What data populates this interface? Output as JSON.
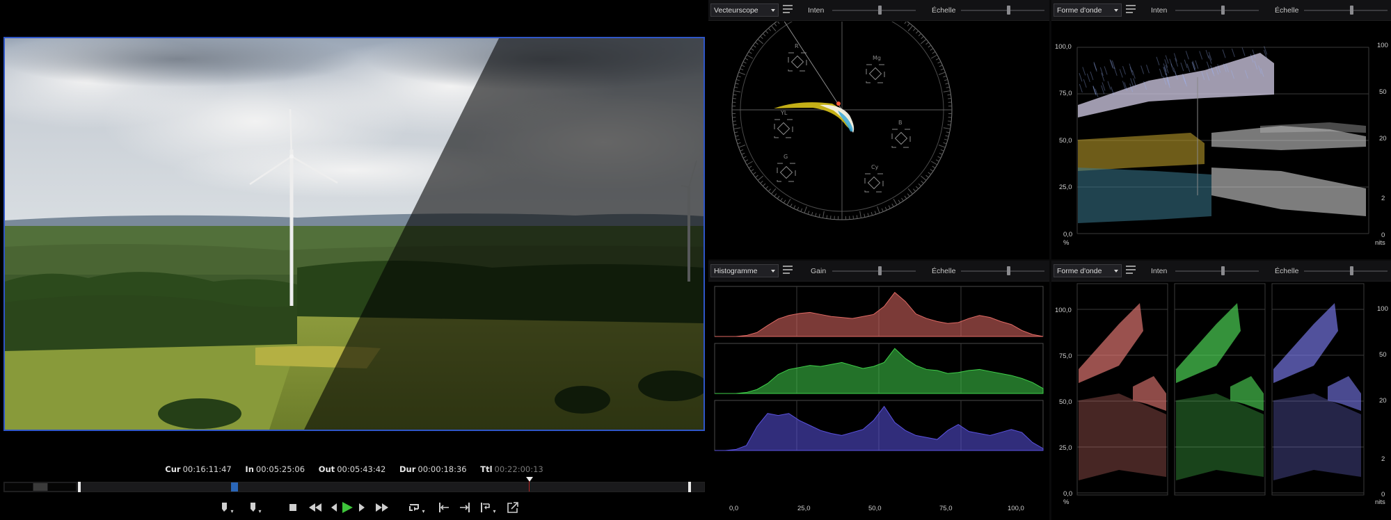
{
  "player": {
    "timecodes": [
      {
        "label": "Cur",
        "value": "00:16:11:47"
      },
      {
        "label": "In",
        "value": "00:05:25:06"
      },
      {
        "label": "Out",
        "value": "00:05:43:42"
      },
      {
        "label": "Dur",
        "value": "00:00:18:36"
      },
      {
        "label": "Ttl",
        "value": "00:22:00:13"
      }
    ],
    "playhead_fraction": 0.325
  },
  "scopes": {
    "vectorscope": {
      "mode": "Vecteurscope",
      "slider1_label": "Inten",
      "slider2_label": "Échelle",
      "targets": [
        "R",
        "Mg",
        "B",
        "Cy",
        "G",
        "YL"
      ]
    },
    "waveform_top": {
      "mode": "Forme d'onde",
      "slider1_label": "Inten",
      "slider2_label": "Échelle",
      "left_ticks": [
        "100,0",
        "75,0",
        "50,0",
        "25,0",
        "0,0"
      ],
      "right_ticks": [
        "100",
        "50",
        "20",
        "2",
        "0"
      ],
      "left_unit": "%",
      "right_unit": "nits"
    },
    "histogram": {
      "mode": "Histogramme",
      "slider1_label": "Gain",
      "slider2_label": "Échelle",
      "x_ticks": [
        "0,0",
        "25,0",
        "50,0",
        "75,0",
        "100,0"
      ],
      "channel_colors": [
        "#e06a64",
        "#3fd04a",
        "#5a52e0"
      ]
    },
    "waveform_rgb": {
      "mode": "Forme d'onde",
      "slider1_label": "Inten",
      "slider2_label": "Échelle",
      "left_ticks": [
        "100,0",
        "75,0",
        "50,0",
        "25,0",
        "0,0"
      ],
      "right_ticks": [
        "100",
        "50",
        "20",
        "2",
        "0"
      ],
      "left_unit": "%",
      "right_unit": "nits"
    }
  },
  "colors": {
    "accent": "#2f56c8",
    "play": "#3ec43a"
  }
}
